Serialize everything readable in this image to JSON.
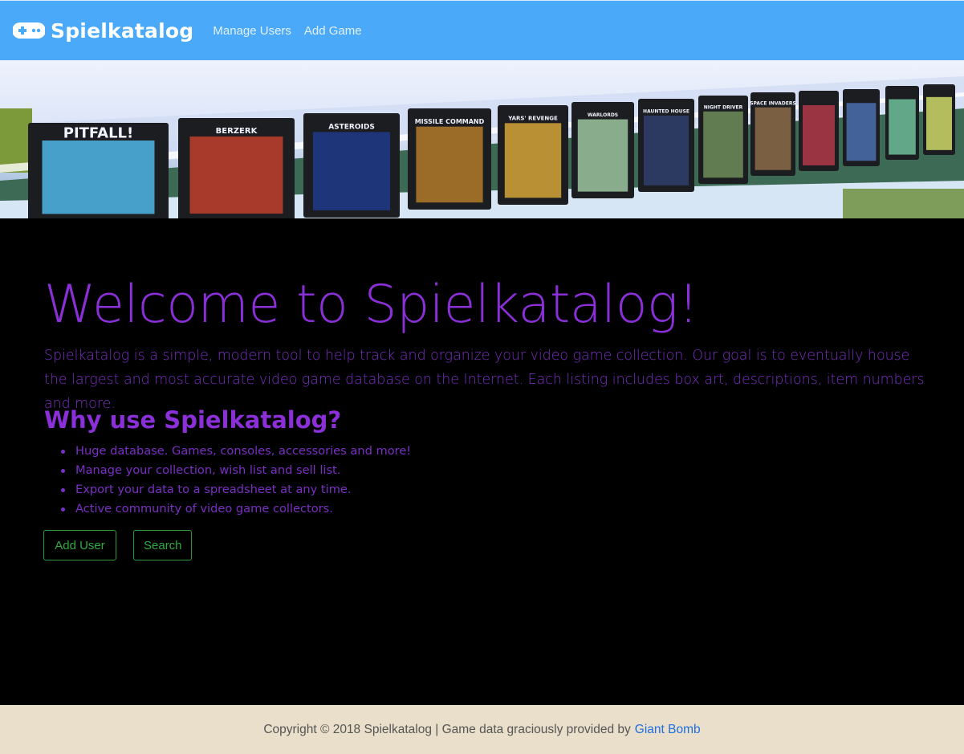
{
  "navbar": {
    "brand": "Spielkatalog",
    "brand_icon": "gamepad-icon",
    "links": [
      "Manage Users",
      "Add Game"
    ],
    "color": "#4aa9f9"
  },
  "hero": {
    "image": "shelf-of-atari-game-cartridges",
    "cartridge_titles": [
      "PITFALL!",
      "BERZERK",
      "ASTEROIDS",
      "MISSILE COMMAND",
      "YARS' REVENGE",
      "WARLORDS",
      "HAUNTED HOUSE",
      "NIGHT DRIVER",
      "SPACE INVADERS"
    ]
  },
  "main": {
    "title": "Welcome to Spielkatalog!",
    "intro": "Spielkatalog is a simple, modern tool to help track and organize your video game collection. Our goal is to eventually house the largest and most accurate video game database on the Internet. Each listing includes box art, descriptions, item numbers and more.",
    "why_heading": "Why use Spielkatalog?",
    "features": [
      "Huge database. Games, consoles, accessories and more!",
      "Manage your collection, wish list and sell list.",
      "Export your data to a spreadsheet at any time.",
      "Active community of video game collectors."
    ],
    "buttons": {
      "add_user": "Add User",
      "search": "Search"
    },
    "accent_color": "#8b2fd9",
    "button_color": "#2faa41"
  },
  "footer": {
    "text": "Copyright © 2018 Spielkatalog | Game data graciously provided by",
    "link": "Giant Bomb",
    "background": "#e9dfca"
  }
}
